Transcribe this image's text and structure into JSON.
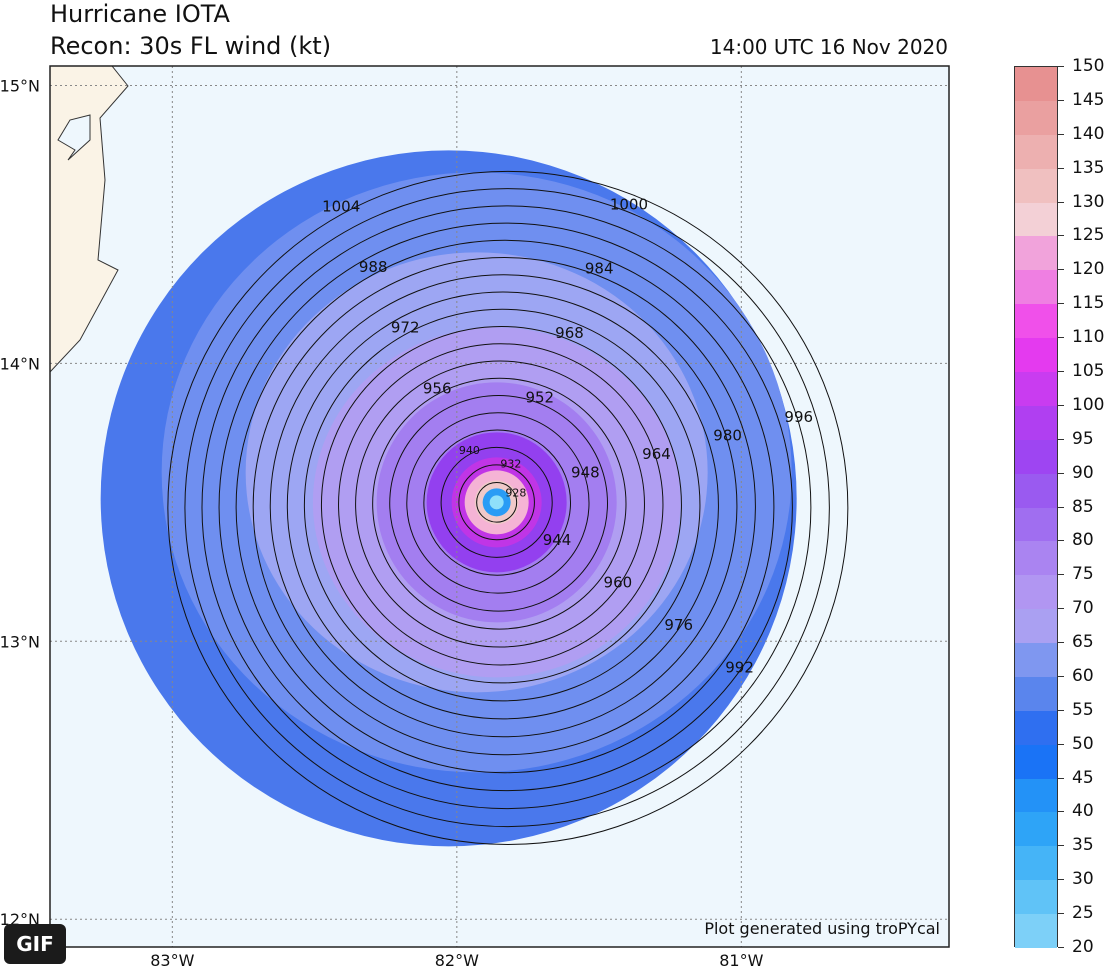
{
  "header": {
    "title": "Hurricane IOTA",
    "subtitle": "Recon: 30s FL wind (kt)",
    "timestamp": "14:00 UTC 16 Nov 2020"
  },
  "map": {
    "lat_labels": [
      "15°N",
      "14°N",
      "13°N",
      "12°N"
    ],
    "lon_labels": [
      "83°W",
      "82°W",
      "81°W"
    ],
    "lat_values": [
      15,
      14,
      13,
      12
    ],
    "lon_values": [
      -83,
      -82,
      -81
    ],
    "extent": {
      "lon_min": -83.43,
      "lon_max": -80.27,
      "lat_min": 11.9,
      "lat_max": 15.07
    },
    "credit": "Plot generated using troPYcal",
    "ocean_color": "#eef7fd",
    "land_color": "#faf3e6",
    "storm_center": {
      "lon": -81.86,
      "lat": 13.5
    },
    "pressure_contours_hpa": [
      {
        "value": "1004",
        "label": "1004"
      },
      {
        "value": "1000",
        "label": "1000"
      },
      {
        "value": "996",
        "label": "996"
      },
      {
        "value": "992",
        "label": "992"
      },
      {
        "value": "988",
        "label": "988"
      },
      {
        "value": "984",
        "label": "984"
      },
      {
        "value": "980",
        "label": "980"
      },
      {
        "value": "976",
        "label": "976"
      },
      {
        "value": "972",
        "label": "972"
      },
      {
        "value": "968",
        "label": "968"
      },
      {
        "value": "964",
        "label": "964"
      },
      {
        "value": "960",
        "label": "960"
      },
      {
        "value": "956",
        "label": "956"
      },
      {
        "value": "952",
        "label": "952"
      },
      {
        "value": "948",
        "label": "948"
      },
      {
        "value": "944",
        "label": "944"
      },
      {
        "value": "940",
        "label": "940"
      },
      {
        "value": "932",
        "label": "932"
      },
      {
        "value": "928",
        "label": "928"
      }
    ],
    "wind_rings_kt": [
      {
        "kt": 55,
        "color": "#4a78ec"
      },
      {
        "kt": 60,
        "color": "#6f8ff0"
      },
      {
        "kt": 65,
        "color": "#9da6f3"
      },
      {
        "kt": 70,
        "color": "#b09ef2"
      },
      {
        "kt": 80,
        "color": "#a37ef0"
      },
      {
        "kt": 95,
        "color": "#9340ef"
      },
      {
        "kt": 110,
        "color": "#c035e6"
      },
      {
        "kt": 125,
        "color": "#f5b3d5"
      },
      {
        "kt": 140,
        "color": "#f0c9c9"
      }
    ]
  },
  "colorbar": {
    "ticks": [
      "150",
      "145",
      "140",
      "135",
      "130",
      "125",
      "120",
      "115",
      "110",
      "105",
      "100",
      "95",
      "90",
      "85",
      "80",
      "75",
      "70",
      "65",
      "60",
      "55",
      "50",
      "45",
      "40",
      "35",
      "30",
      "25",
      "20"
    ],
    "colors": [
      "#e79191",
      "#eaa0a0",
      "#edb0b0",
      "#f0c0c0",
      "#f3d0d6",
      "#f1a3db",
      "#ef7fe2",
      "#f050ea",
      "#e43aef",
      "#c93cf0",
      "#b03ff1",
      "#9e45f2",
      "#9a5af0",
      "#a06ef0",
      "#aa84f1",
      "#b196f2",
      "#aaa0f2",
      "#7f97f0",
      "#5a85ed",
      "#2f6ff0",
      "#1a73f6",
      "#2392f7",
      "#2ea4f7",
      "#45b4f7",
      "#60c3f7",
      "#7dd0f8"
    ]
  },
  "overlay": {
    "badge": "GIF"
  }
}
